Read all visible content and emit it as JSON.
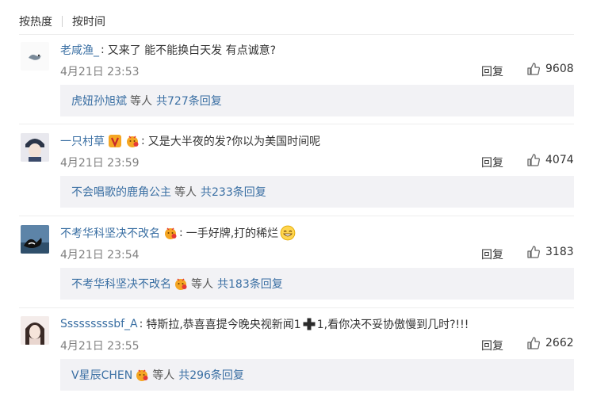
{
  "sort_options": [
    "按热度",
    "按时间"
  ],
  "comments": [
    {
      "user": "老咸渔_",
      "text": "又来了 能不能换白天发 有点诚意?",
      "time": "4月21日 23:53",
      "reply_label": "回复",
      "likes": "9608",
      "replies": {
        "user": "虎妞孙旭斌",
        "mid": "等人",
        "total": "共727条回复"
      }
    },
    {
      "user": "一只村草",
      "text": "又是大半夜的发?你以为美国时间呢",
      "time": "4月21日 23:59",
      "reply_label": "回复",
      "likes": "4074",
      "replies": {
        "user": "不会唱歌的鹿角公主",
        "mid": "等人",
        "total": "共233条回复"
      }
    },
    {
      "user": "不考华科坚决不改名",
      "text": "一手好牌,打的稀烂",
      "time": "4月21日 23:54",
      "reply_label": "回复",
      "likes": "3183",
      "replies": {
        "user": "不考华科坚决不改名",
        "mid": "等人",
        "total": "共183条回复"
      }
    },
    {
      "user": "Sssssssssbf_A",
      "text": "特斯拉,恭喜喜提今晚央视新闻1",
      "text_tail": "1,看你决不妥协傲慢到几时?!!!",
      "time": "4月21日 23:55",
      "reply_label": "回复",
      "likes": "2662",
      "replies": {
        "user": "V星辰CHEN",
        "mid": "等人",
        "total": "共296条回复"
      }
    }
  ],
  "colors": {
    "link": "#3a6fa3",
    "reply_bg": "#f2f2f5",
    "meta": "#808080",
    "badge_orange": "#f5a623"
  },
  "icons": [
    "thumb-up-icon",
    "vip-badge-icon",
    "fan-badge-icon",
    "grin-emoji-icon",
    "plus-emoji-icon"
  ]
}
